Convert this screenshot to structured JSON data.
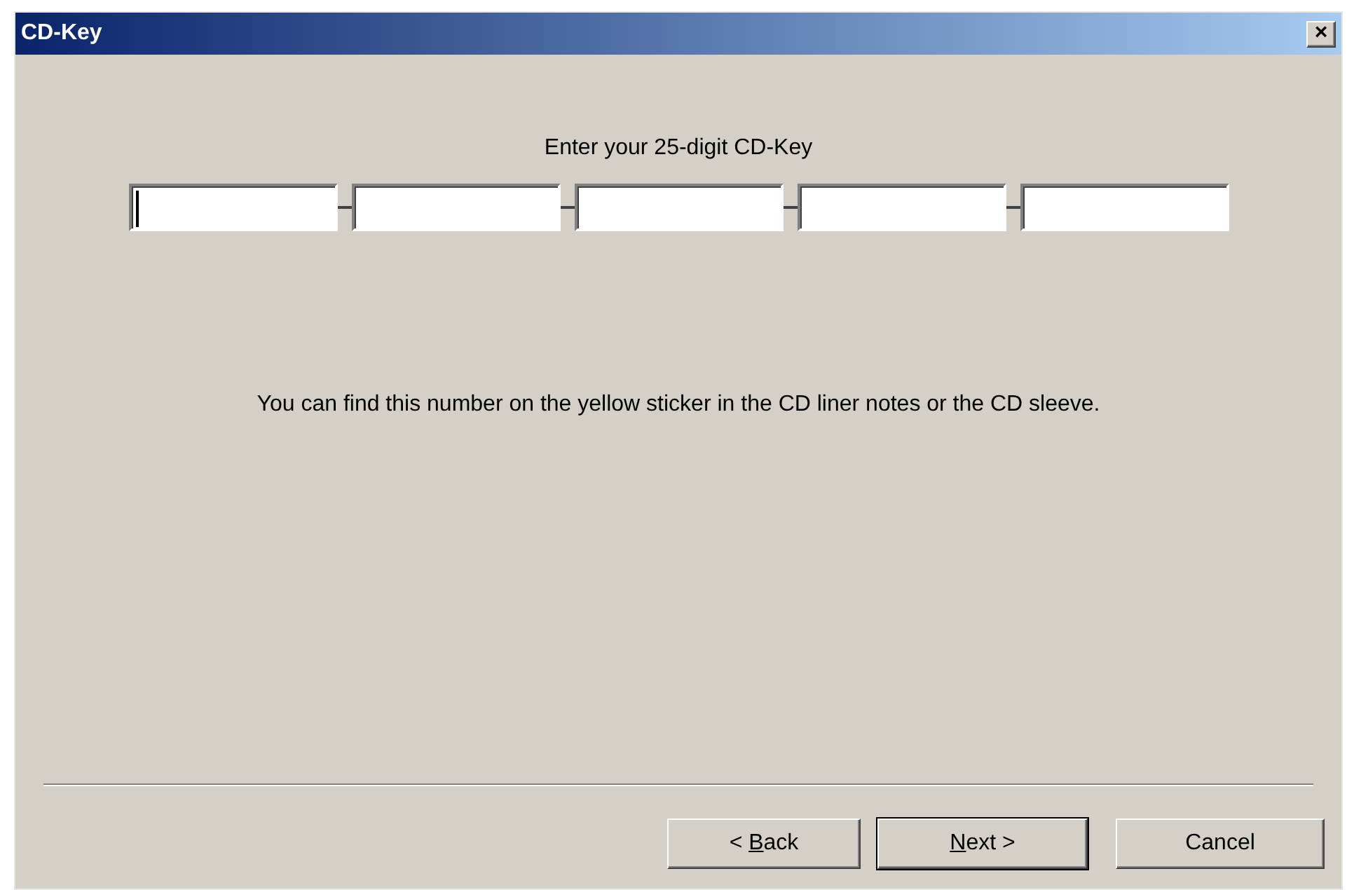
{
  "window": {
    "title": "CD-Key",
    "close": "×"
  },
  "prompt": "Enter your 25-digit CD-Key",
  "key_fields": [
    {
      "focused": true
    },
    {
      "focused": false
    },
    {
      "focused": false
    },
    {
      "focused": false
    },
    {
      "focused": false
    }
  ],
  "hint": "You can find this number on the yellow sticker in the CD liner notes or the CD sleeve.",
  "buttons": [
    {
      "label_start": "< ",
      "access_key": "B",
      "label_end": "ack",
      "default": false
    },
    {
      "access_key": "N",
      "label_end": "ext >",
      "default": true
    },
    {
      "label_end": "Cancel",
      "default": false
    }
  ]
}
